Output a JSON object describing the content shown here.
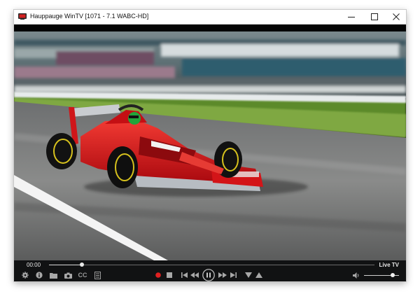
{
  "window": {
    "title": "Hauppauge WinTV [1071 - 7.1  WABC-HD]"
  },
  "player": {
    "time": "00:00",
    "live_label": "Live TV",
    "cc_label": "CC",
    "seek_progress": 0.1,
    "volume_level": 0.82
  },
  "icons": {
    "settings": "gear-icon",
    "info": "info-icon",
    "folder": "folder-icon",
    "snapshot": "camera-icon",
    "captions": "cc-icon",
    "guide": "list-icon",
    "record": "record-icon",
    "stop": "stop-icon",
    "skip_back": "skip-back-icon",
    "rewind": "rewind-icon",
    "pause": "pause-icon",
    "fast_forward": "fast-forward-icon",
    "skip_forward": "skip-forward-icon",
    "channel_down": "channel-down-icon",
    "channel_up": "channel-up-icon",
    "volume": "volume-icon"
  },
  "colors": {
    "record": "#e02020",
    "control_icon": "#b0b0b0",
    "control_bg": "#111213",
    "car_red": "#d9161c"
  }
}
